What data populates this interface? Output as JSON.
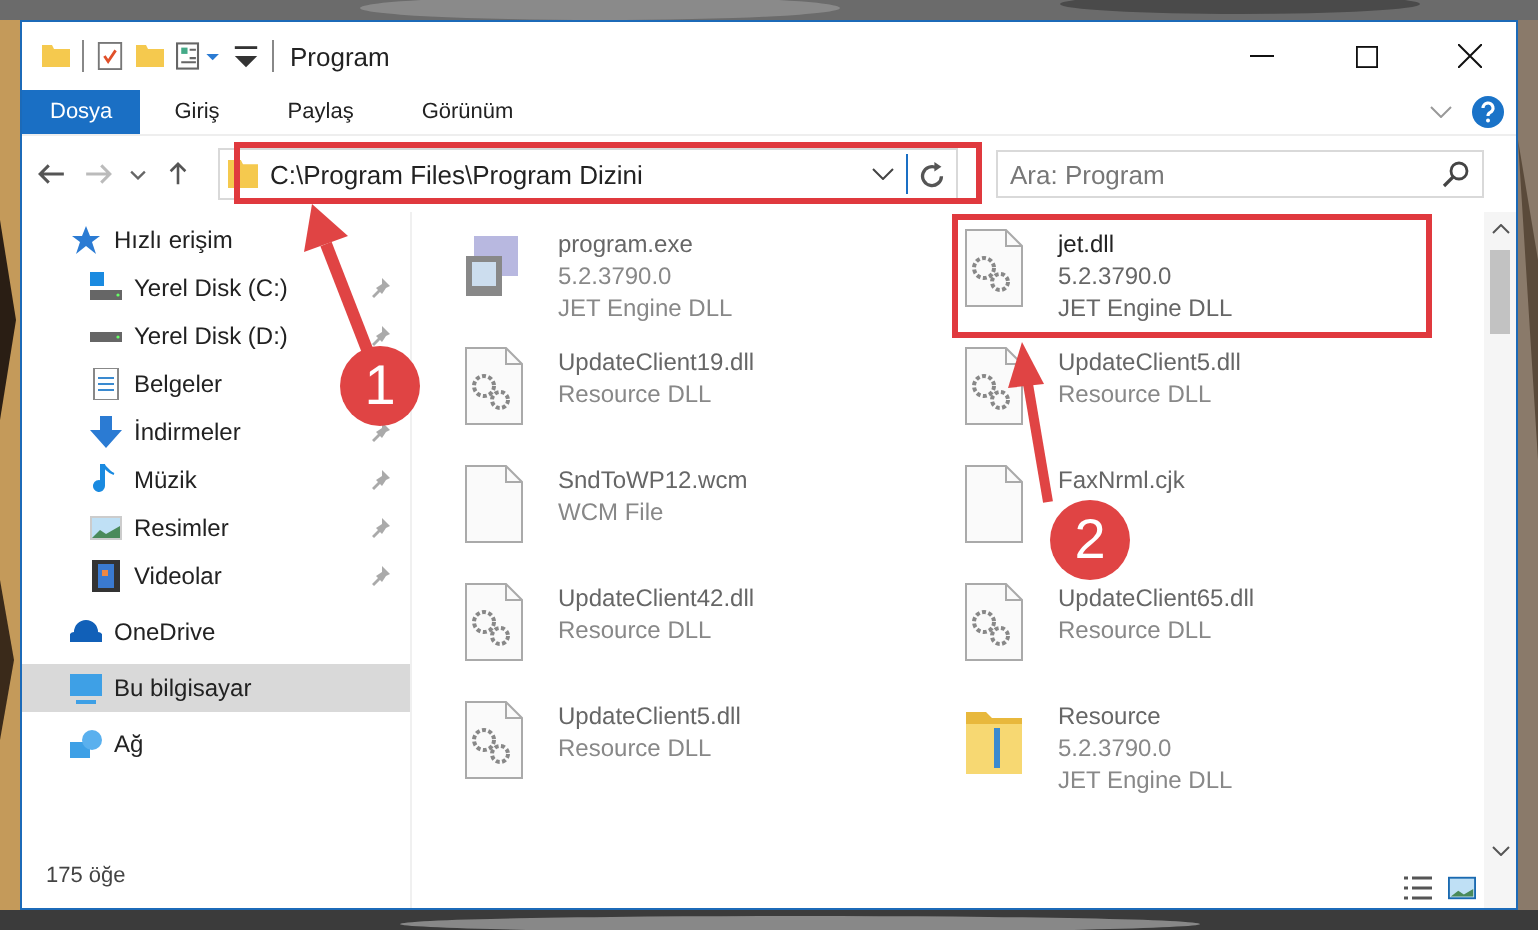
{
  "window": {
    "title": "Program"
  },
  "ribbon_tabs": [
    {
      "label": "Dosya",
      "selected": true
    },
    {
      "label": "Giriş",
      "selected": false
    },
    {
      "label": "Paylaş",
      "selected": false
    },
    {
      "label": "Görünüm",
      "selected": false
    }
  ],
  "address_bar": {
    "path": "C:\\Program Files\\Program Dizini"
  },
  "search": {
    "placeholder": "Ara: Program"
  },
  "sidebar": {
    "items": [
      {
        "label": "Hızlı erişim",
        "kind": "star",
        "selected": false,
        "children": [
          {
            "label": "Yerel Disk (C:)",
            "kind": "drive-c",
            "pinned": true,
            "selected": false
          },
          {
            "label": "Yerel Disk (D:)",
            "kind": "drive",
            "pinned": true,
            "selected": false
          },
          {
            "label": "Belgeler",
            "kind": "docs",
            "selected": false
          },
          {
            "label": "İndirmeler",
            "kind": "download",
            "pinned": true,
            "selected": false
          },
          {
            "label": "Müzik",
            "kind": "music",
            "pinned": true,
            "selected": false
          },
          {
            "label": "Resimler",
            "kind": "pictures",
            "pinned": true,
            "selected": false
          },
          {
            "label": "Videolar",
            "kind": "video",
            "pinned": true,
            "selected": false
          }
        ]
      },
      {
        "label": "OneDrive",
        "kind": "cloud",
        "selected": false
      },
      {
        "label": "Bu bilgisayar",
        "kind": "pc",
        "selected": true
      },
      {
        "label": "Ağ",
        "kind": "network",
        "selected": false
      }
    ]
  },
  "files": [
    {
      "name": "program.exe",
      "details": [
        "5.2.3790.0",
        "JET Engine DLL"
      ],
      "kind": "exe",
      "blurred": true
    },
    {
      "name": "jet.dll",
      "details": [
        "5.2.3790.0",
        "JET Engine DLL"
      ],
      "kind": "dll",
      "blurred": false
    },
    {
      "name": "UpdateClient19.dll",
      "details": [
        "Resource DLL"
      ],
      "kind": "dll",
      "blurred": true
    },
    {
      "name": "UpdateClient5.dll",
      "details": [
        "Resource DLL"
      ],
      "kind": "dll",
      "blurred": true
    },
    {
      "name": "SndToWP12.wcm",
      "details": [
        "WCM File"
      ],
      "kind": "file",
      "blurred": true
    },
    {
      "name": "FaxNrml.cjk",
      "kind": "file",
      "blurred": true
    },
    {
      "name": "UpdateClient42.dll",
      "details": [
        "Resource DLL"
      ],
      "kind": "dll",
      "blurred": true
    },
    {
      "name": "UpdateClient65.dll",
      "details": [
        "Resource DLL"
      ],
      "kind": "dll",
      "blurred": true
    },
    {
      "name": "UpdateClient5.dll",
      "details": [
        "Resource DLL"
      ],
      "kind": "dll",
      "blurred": true
    },
    {
      "name": "Resource",
      "details": [
        "5.2.3790.0",
        "JET Engine DLL"
      ],
      "kind": "folder",
      "blurred": true
    }
  ],
  "status_bar": {
    "count": "175 öğe"
  },
  "annotations": [
    {
      "label": "1"
    },
    {
      "label": "2"
    }
  ]
}
